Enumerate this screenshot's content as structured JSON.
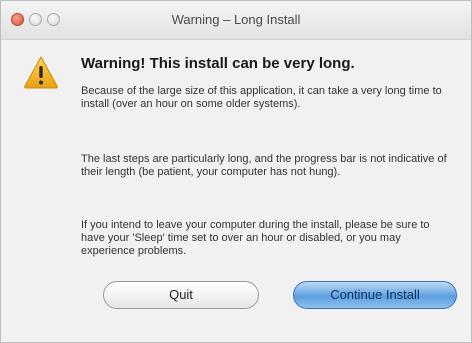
{
  "window": {
    "title": "Warning – Long Install",
    "controls": [
      "close",
      "minimize",
      "zoom"
    ]
  },
  "dialog": {
    "icon": "warning-triangle-icon",
    "heading": "Warning! This install can be very long.",
    "paragraphs": [
      "Because of the large size of this application, it can take a very long time to install (over an hour on some older systems).",
      "The last steps are particularly long, and the progress bar is not indicative of their length (be patient, your computer has not hung).",
      "If you intend to leave your computer during the install, please be sure to have your 'Sleep' time set to over an hour or disabled, or you may experience problems."
    ]
  },
  "buttons": {
    "quit": "Quit",
    "continue": "Continue Install"
  },
  "colors": {
    "default_button": "#5d9fe0",
    "warning_icon": "#f3b21d"
  }
}
